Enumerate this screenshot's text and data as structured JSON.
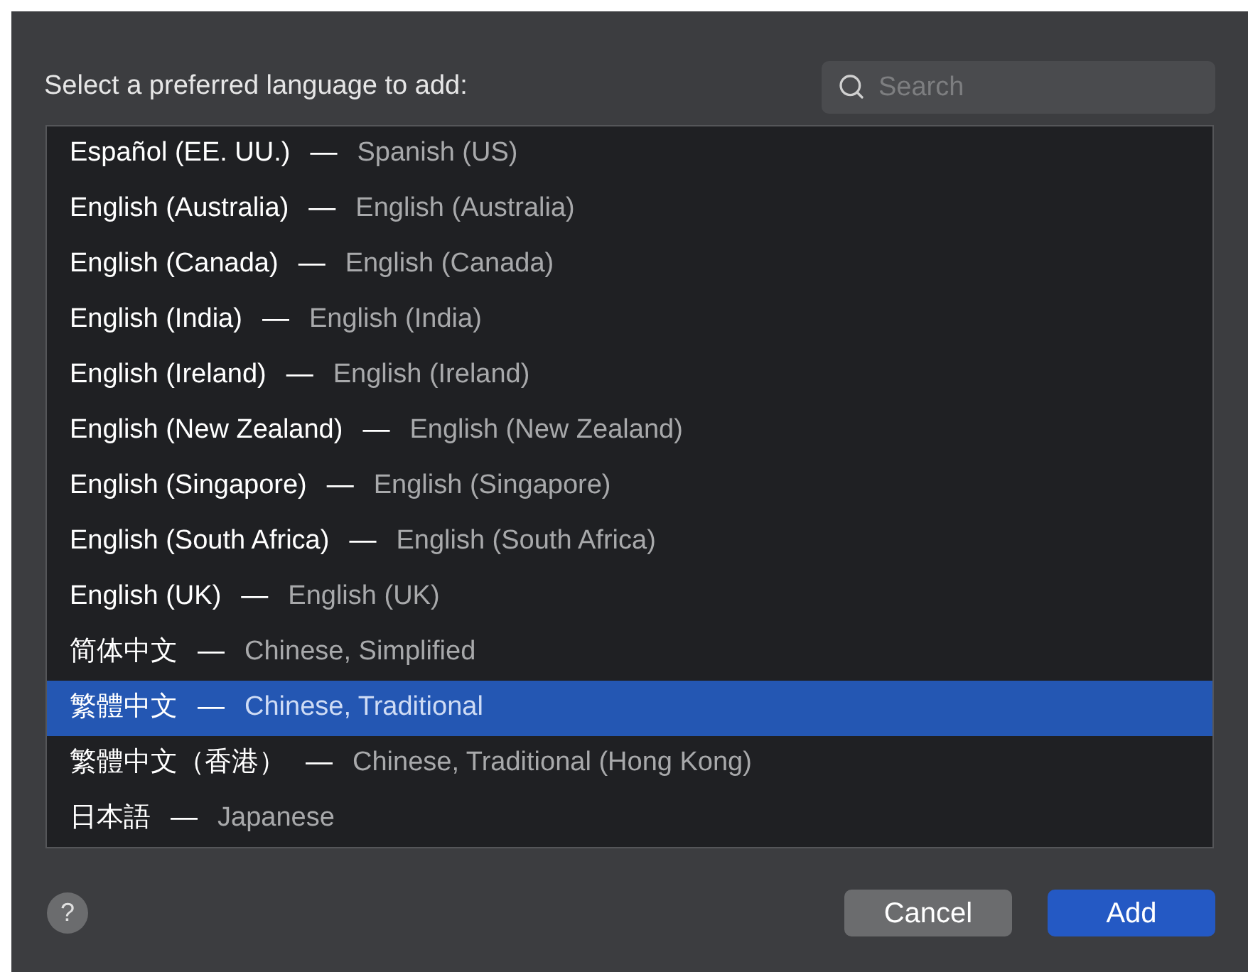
{
  "prompt": "Select a preferred language to add:",
  "search": {
    "placeholder": "Search"
  },
  "languages": [
    {
      "native": "Español (EE. UU.)",
      "english": "Spanish (US)",
      "selected": false
    },
    {
      "native": "English (Australia)",
      "english": "English (Australia)",
      "selected": false
    },
    {
      "native": "English (Canada)",
      "english": "English (Canada)",
      "selected": false
    },
    {
      "native": "English (India)",
      "english": "English (India)",
      "selected": false
    },
    {
      "native": "English (Ireland)",
      "english": "English (Ireland)",
      "selected": false
    },
    {
      "native": "English (New Zealand)",
      "english": "English (New Zealand)",
      "selected": false
    },
    {
      "native": "English (Singapore)",
      "english": "English (Singapore)",
      "selected": false
    },
    {
      "native": "English (South Africa)",
      "english": "English (South Africa)",
      "selected": false
    },
    {
      "native": "English (UK)",
      "english": "English (UK)",
      "selected": false
    },
    {
      "native": "简体中文",
      "english": "Chinese, Simplified",
      "selected": false
    },
    {
      "native": "繁體中文",
      "english": "Chinese, Traditional",
      "selected": true
    },
    {
      "native": "繁體中文（香港）",
      "english": "Chinese, Traditional (Hong Kong)",
      "selected": false
    },
    {
      "native": "日本語",
      "english": "Japanese",
      "selected": false
    }
  ],
  "separator": "—",
  "help": "?",
  "buttons": [
    {
      "label": "Cancel",
      "kind": "secondary"
    },
    {
      "label": "Add",
      "kind": "primary"
    }
  ]
}
